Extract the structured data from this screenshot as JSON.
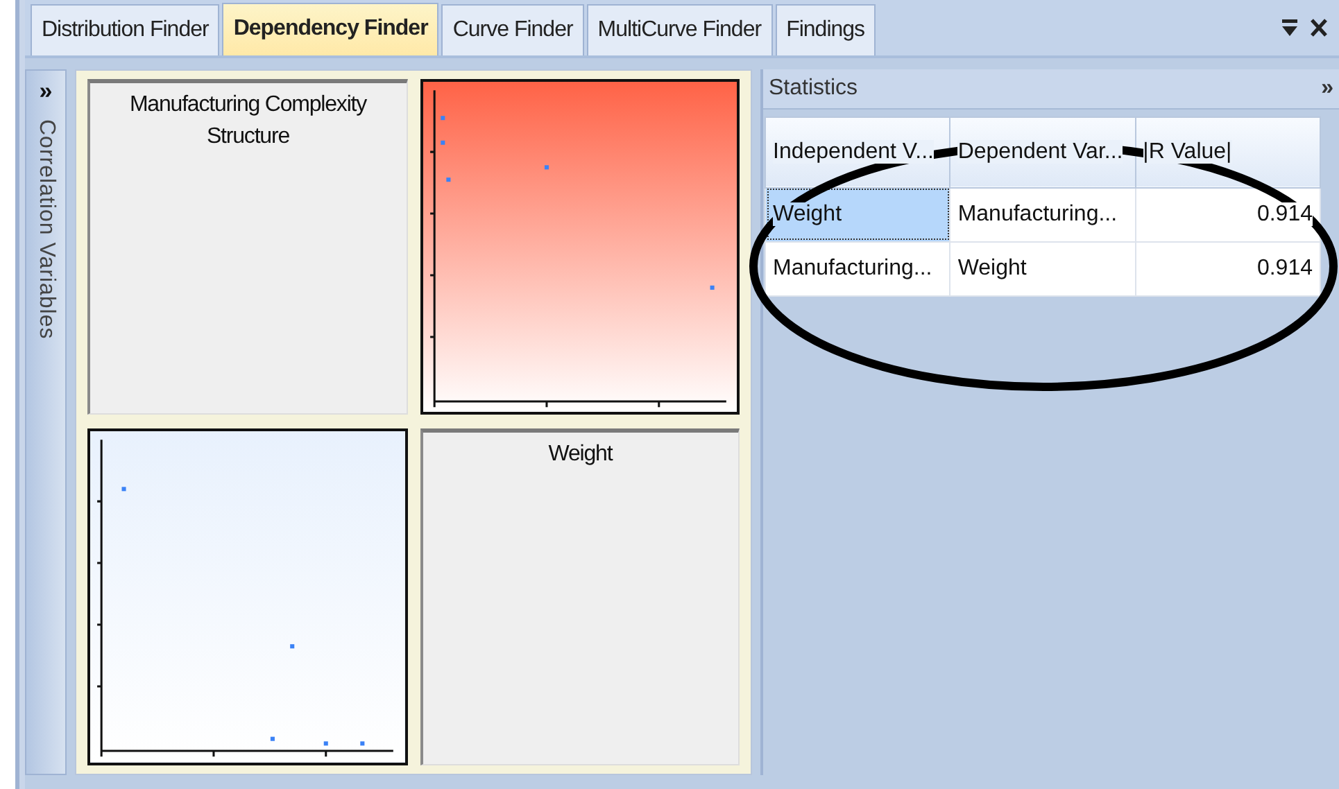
{
  "tabs": [
    {
      "label": "Distribution Finder",
      "selected": false
    },
    {
      "label": "Dependency Finder",
      "selected": true
    },
    {
      "label": "Curve Finder",
      "selected": false
    },
    {
      "label": "MultiCurve Finder",
      "selected": false
    },
    {
      "label": "Findings",
      "selected": false
    }
  ],
  "side_panel": {
    "toggle": "»",
    "title": "Correlation Variables"
  },
  "matrix": {
    "cells": [
      {
        "kind": "label",
        "text": "Manufacturing Complexity Structure"
      },
      {
        "kind": "scatter",
        "color": "#ff6347"
      },
      {
        "kind": "scatter",
        "color": "#e8f1fd"
      },
      {
        "kind": "label",
        "text": "Weight"
      }
    ]
  },
  "statistics": {
    "title": "Statistics",
    "toggle": "»",
    "columns": [
      "Independent V...",
      "Dependent Var...",
      "|R Value|"
    ],
    "rows": [
      {
        "cells": [
          "Weight",
          "Manufacturing...",
          "0.914"
        ],
        "selected": true
      },
      {
        "cells": [
          "Manufacturing...",
          "Weight",
          "0.914"
        ],
        "selected": false
      }
    ]
  }
}
